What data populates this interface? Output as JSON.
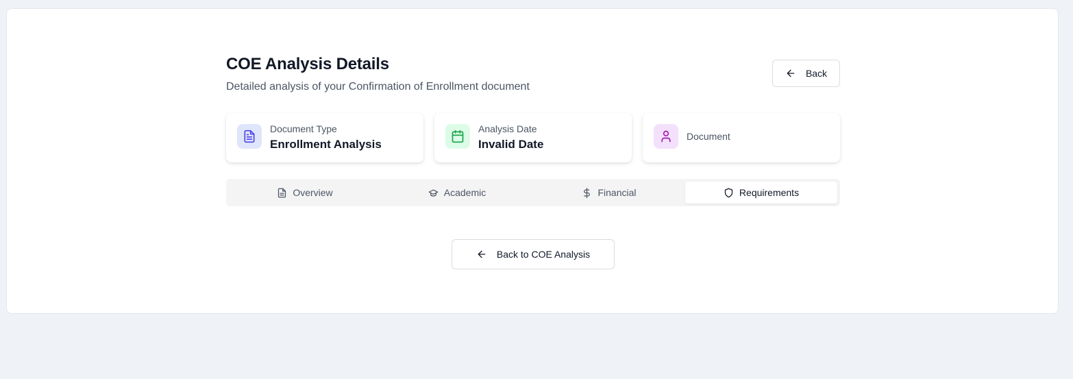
{
  "header": {
    "title": "COE Analysis Details",
    "subtitle": "Detailed analysis of your Confirmation of Enrollment document",
    "back_label": "Back"
  },
  "cards": [
    {
      "label": "Document Type",
      "value": "Enrollment Analysis",
      "icon": "document-icon",
      "icon_bg": "#dfe6fb",
      "icon_color": "#4f46e5"
    },
    {
      "label": "Analysis Date",
      "value": "Invalid Date",
      "icon": "calendar-icon",
      "icon_bg": "#dcfce7",
      "icon_color": "#16a34a"
    },
    {
      "label": "Document",
      "icon": "user-icon",
      "icon_bg": "#f3e0fb",
      "icon_color": "#a21caf"
    }
  ],
  "tabs": [
    {
      "label": "Overview",
      "icon": "document-icon",
      "active": false
    },
    {
      "label": "Academic",
      "icon": "graduation-cap-icon",
      "active": false
    },
    {
      "label": "Financial",
      "icon": "dollar-icon",
      "active": false
    },
    {
      "label": "Requirements",
      "icon": "shield-icon",
      "active": true
    }
  ],
  "footer": {
    "back_to_label": "Back to COE Analysis"
  }
}
